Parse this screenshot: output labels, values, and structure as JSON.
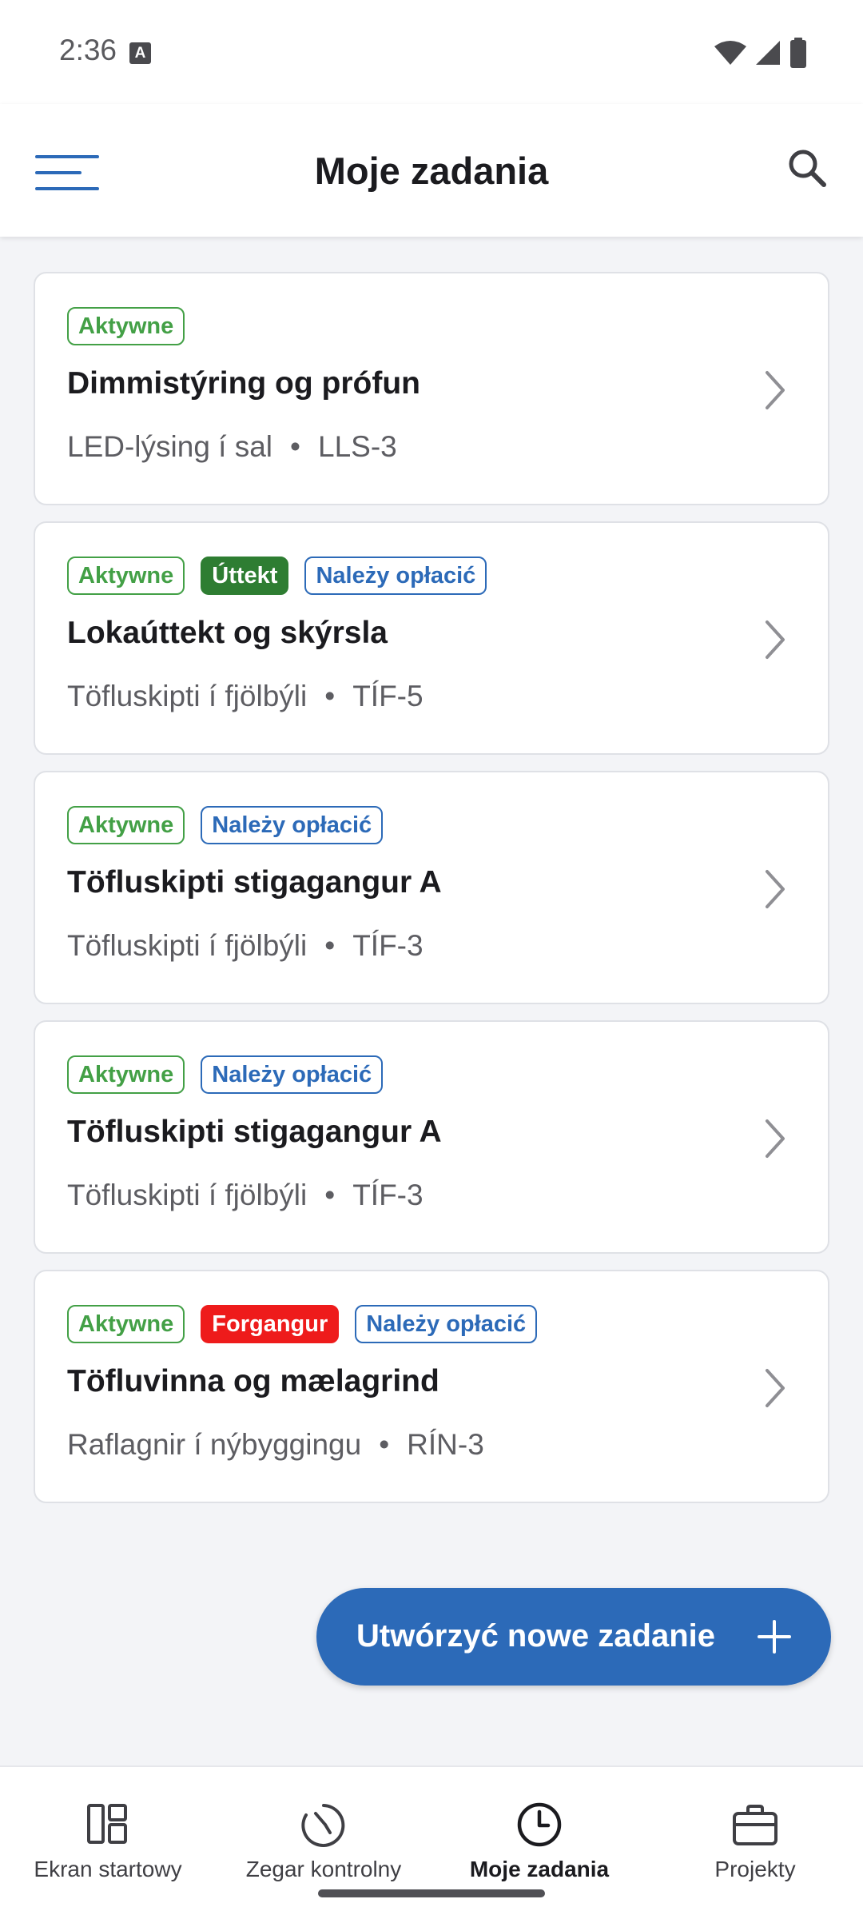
{
  "status_bar": {
    "time": "2:36",
    "icons": [
      "a-notification-icon",
      "wifi-icon",
      "signal-icon",
      "battery-icon"
    ]
  },
  "app_bar": {
    "title": "Moje zadania",
    "menu_icon": "hamburger-menu-icon",
    "search_icon": "search-icon"
  },
  "colors": {
    "primary": "#2c6ab8",
    "active_green": "#43a046",
    "dark_green": "#2e7d32",
    "red": "#ee1b1b",
    "background": "#f3f4f7"
  },
  "tasks": [
    {
      "badges": [
        {
          "label": "Aktywne",
          "style": "outline-green"
        }
      ],
      "title": "Dimmistýring og prófun",
      "project": "LED-lýsing í sal",
      "code": "LLS-3"
    },
    {
      "badges": [
        {
          "label": "Aktywne",
          "style": "outline-green"
        },
        {
          "label": "Úttekt",
          "style": "filled-green"
        },
        {
          "label": "Należy opłacić",
          "style": "outline-blue"
        }
      ],
      "title": "Lokaúttekt og skýrsla",
      "project": "Töfluskipti í fjölbýli",
      "code": "TÍF-5"
    },
    {
      "badges": [
        {
          "label": "Aktywne",
          "style": "outline-green"
        },
        {
          "label": "Należy opłacić",
          "style": "outline-blue"
        }
      ],
      "title": "Töfluskipti stigagangur A",
      "project": "Töfluskipti í fjölbýli",
      "code": "TÍF-3"
    },
    {
      "badges": [
        {
          "label": "Aktywne",
          "style": "outline-green"
        },
        {
          "label": "Należy opłacić",
          "style": "outline-blue"
        }
      ],
      "title": "Töfluskipti stigagangur A",
      "project": "Töfluskipti í fjölbýli",
      "code": "TÍF-3"
    },
    {
      "badges": [
        {
          "label": "Aktywne",
          "style": "outline-green"
        },
        {
          "label": "Forgangur",
          "style": "filled-red"
        },
        {
          "label": "Należy opłacić",
          "style": "outline-blue"
        }
      ],
      "title": "Töfluvinna og mælagrind",
      "project": "Raflagnir í nýbyggingu",
      "code": "RÍN-3"
    }
  ],
  "subtitle_separator": "•",
  "fab": {
    "label": "Utwórzyć nowe zadanie",
    "icon": "plus-icon"
  },
  "bottom_nav": [
    {
      "label": "Ekran startowy",
      "icon": "dashboard-icon",
      "active": false
    },
    {
      "label": "Zegar kontrolny",
      "icon": "timer-clock-icon",
      "active": false
    },
    {
      "label": "Moje zadania",
      "icon": "clock-icon",
      "active": true
    },
    {
      "label": "Projekty",
      "icon": "briefcase-icon",
      "active": false
    }
  ]
}
